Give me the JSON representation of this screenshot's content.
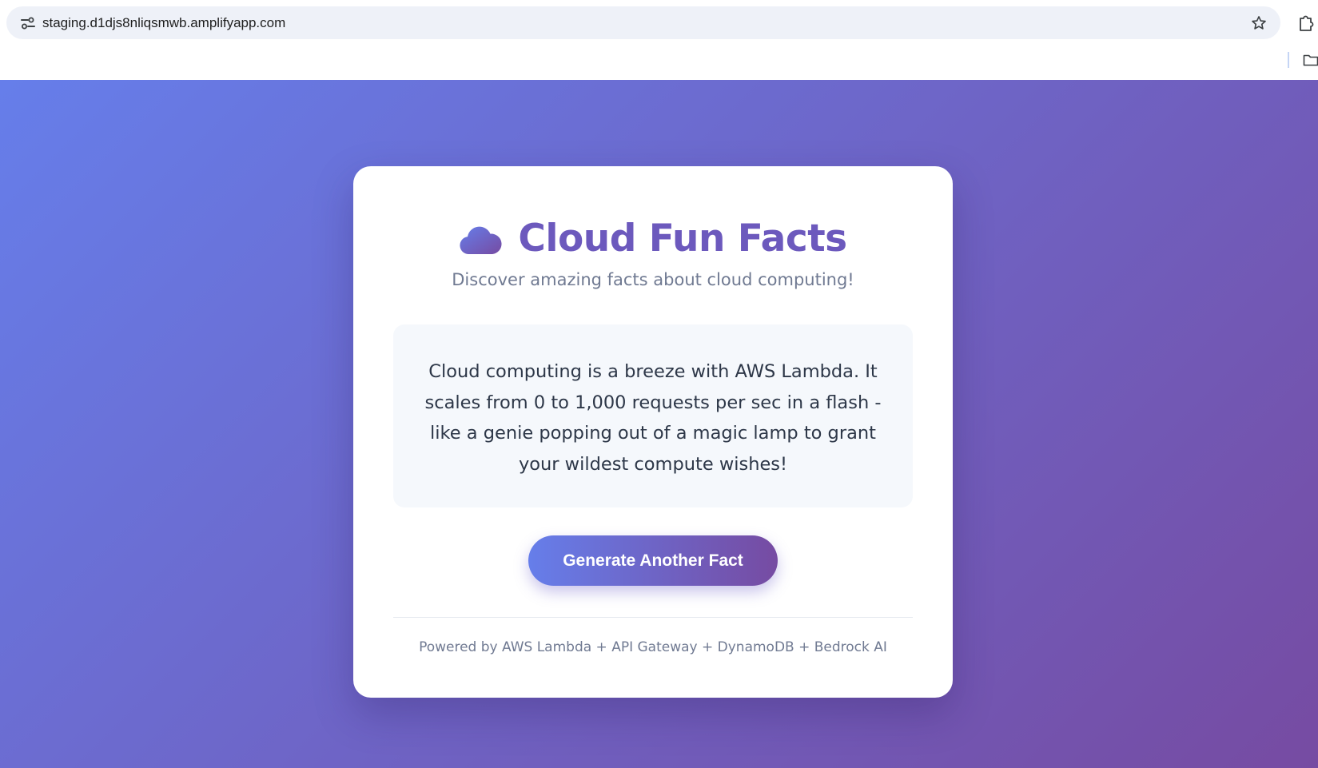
{
  "browser": {
    "url": "staging.d1djs8nliqsmwb.amplifyapp.com",
    "icons": [
      "site-info-icon",
      "star-icon",
      "extensions-icon",
      "folder-icon"
    ]
  },
  "card": {
    "title": "Cloud Fun Facts",
    "title_icon": "cloud-icon",
    "subtitle": "Discover amazing facts about cloud computing!",
    "fact": "Cloud computing is a breeze with AWS Lambda. It scales from 0 to 1,000 requests per sec in a flash - like a genie popping out of a magic lamp to grant your wildest compute wishes!",
    "button_label": "Generate Another Fact",
    "footer": "Powered by AWS Lambda + API Gateway + DynamoDB + Bedrock AI"
  },
  "colors": {
    "gradient_start": "#667eea",
    "gradient_end": "#764ba2",
    "title": "#6c59bd",
    "muted_text": "#707a92",
    "fact_text": "#2d3748",
    "fact_background": "#f5f8fc"
  }
}
